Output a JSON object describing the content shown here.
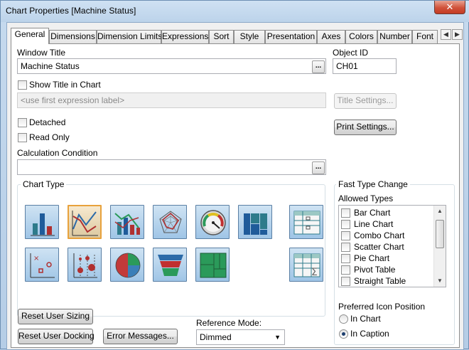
{
  "window": {
    "title": "Chart Properties [Machine Status]",
    "close_glyph": "✕"
  },
  "tabs": [
    {
      "label": "General",
      "active": true
    },
    {
      "label": "Dimensions"
    },
    {
      "label": "Dimension Limits"
    },
    {
      "label": "Expressions"
    },
    {
      "label": "Sort"
    },
    {
      "label": "Style"
    },
    {
      "label": "Presentation"
    },
    {
      "label": "Axes"
    },
    {
      "label": "Colors"
    },
    {
      "label": "Number"
    },
    {
      "label": "Font"
    }
  ],
  "tab_scroll": {
    "left_glyph": "◀",
    "right_glyph": "▶"
  },
  "general": {
    "window_title_label": "Window Title",
    "window_title_value": "Machine Status",
    "ellipsis": "...",
    "object_id_label": "Object ID",
    "object_id_value": "CH01",
    "show_title_label": "Show Title in Chart",
    "title_placeholder": "<use first expression label>",
    "title_settings_label": "Title Settings...",
    "detached_label": "Detached",
    "read_only_label": "Read Only",
    "print_settings_label": "Print Settings...",
    "calc_condition_label": "Calculation Condition",
    "calc_condition_value": ""
  },
  "chart_type": {
    "group_label": "Chart Type",
    "icons": [
      {
        "name": "bar-chart-icon"
      },
      {
        "name": "line-chart-icon",
        "selected": true
      },
      {
        "name": "combo-chart-icon"
      },
      {
        "name": "radar-chart-icon"
      },
      {
        "name": "gauge-chart-icon"
      },
      {
        "name": "mekko-chart-icon"
      },
      {
        "name": "pivot-table-icon"
      },
      {
        "name": "scatter-chart-icon"
      },
      {
        "name": "grid-chart-icon"
      },
      {
        "name": "pie-chart-icon"
      },
      {
        "name": "funnel-chart-icon"
      },
      {
        "name": "block-chart-icon"
      },
      {
        "name": "straight-table-icon"
      }
    ]
  },
  "fast_type": {
    "group_label": "Fast Type Change",
    "allowed_label": "Allowed Types",
    "items": [
      "Bar Chart",
      "Line Chart",
      "Combo Chart",
      "Scatter Chart",
      "Pie Chart",
      "Pivot Table",
      "Straight Table"
    ],
    "scroll_up": "▲",
    "scroll_down": "▼",
    "icon_position_label": "Preferred Icon Position",
    "in_chart_label": "In Chart",
    "in_caption_label": "In Caption",
    "selected_position": "In Caption"
  },
  "bottom": {
    "reset_sizing_label": "Reset User Sizing",
    "reset_docking_label": "Reset User Docking",
    "error_messages_label": "Error Messages...",
    "reference_mode_label": "Reference Mode:",
    "reference_mode_value": "Dimmed",
    "caret": "▼"
  },
  "colors": {
    "tab_border": "#8d8d8d",
    "icon_selected_border": "#e8a23c",
    "icon_border": "#5a7fa4"
  }
}
